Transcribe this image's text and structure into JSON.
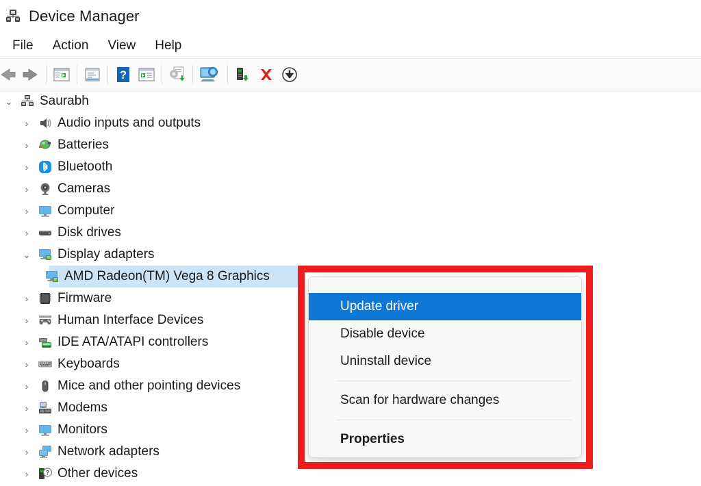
{
  "window": {
    "title": "Device Manager",
    "app_icon": "device-manager-icon"
  },
  "menubar": {
    "items": [
      {
        "label": "File"
      },
      {
        "label": "Action"
      },
      {
        "label": "View"
      },
      {
        "label": "Help"
      }
    ]
  },
  "toolbar": {
    "buttons": [
      {
        "icon": "back-arrow-icon",
        "label": "Back"
      },
      {
        "icon": "forward-arrow-icon",
        "label": "Forward"
      },
      {
        "icon": "show-hide-console-tree-icon",
        "label": "Show/Hide Console Tree"
      },
      {
        "icon": "properties-icon",
        "label": "Properties"
      },
      {
        "icon": "help-icon",
        "label": "Help"
      },
      {
        "icon": "update-driver-panel-icon",
        "label": "Update Driver"
      },
      {
        "icon": "update-driver-gear-icon",
        "label": "Update Driver Software"
      },
      {
        "icon": "scan-for-hardware-changes-icon",
        "label": "Scan for hardware changes"
      },
      {
        "icon": "enable-device-icon",
        "label": "Enable device"
      },
      {
        "icon": "uninstall-device-icon",
        "label": "Uninstall device"
      },
      {
        "icon": "disable-device-icon",
        "label": "Disable device"
      }
    ]
  },
  "tree": {
    "nodes": [
      {
        "label": "Saurabh",
        "icon": "computer-root-icon",
        "depth": 0,
        "expander": "expanded",
        "selected": false
      },
      {
        "label": "Audio inputs and outputs",
        "icon": "speaker-icon",
        "depth": 1,
        "expander": "collapsed",
        "selected": false
      },
      {
        "label": "Batteries",
        "icon": "battery-icon",
        "depth": 1,
        "expander": "collapsed",
        "selected": false
      },
      {
        "label": "Bluetooth",
        "icon": "bluetooth-icon",
        "depth": 1,
        "expander": "collapsed",
        "selected": false
      },
      {
        "label": "Cameras",
        "icon": "camera-icon",
        "depth": 1,
        "expander": "collapsed",
        "selected": false
      },
      {
        "label": "Computer",
        "icon": "monitor-icon",
        "depth": 1,
        "expander": "collapsed",
        "selected": false
      },
      {
        "label": "Disk drives",
        "icon": "disk-drive-icon",
        "depth": 1,
        "expander": "collapsed",
        "selected": false
      },
      {
        "label": "Display adapters",
        "icon": "display-adapter-icon",
        "depth": 1,
        "expander": "expanded",
        "selected": false
      },
      {
        "label": "AMD Radeon(TM) Vega 8 Graphics",
        "icon": "display-adapter-icon",
        "depth": 2,
        "expander": "none",
        "selected": true
      },
      {
        "label": "Firmware",
        "icon": "firmware-chip-icon",
        "depth": 1,
        "expander": "collapsed",
        "selected": false
      },
      {
        "label": "Human Interface Devices",
        "icon": "gamepad-icon",
        "depth": 1,
        "expander": "collapsed",
        "selected": false
      },
      {
        "label": "IDE ATA/ATAPI controllers",
        "icon": "ide-controller-icon",
        "depth": 1,
        "expander": "collapsed",
        "selected": false
      },
      {
        "label": "Keyboards",
        "icon": "keyboard-icon",
        "depth": 1,
        "expander": "collapsed",
        "selected": false
      },
      {
        "label": "Mice and other pointing devices",
        "icon": "mouse-icon",
        "depth": 1,
        "expander": "collapsed",
        "selected": false
      },
      {
        "label": "Modems",
        "icon": "modem-icon",
        "depth": 1,
        "expander": "collapsed",
        "selected": false
      },
      {
        "label": "Monitors",
        "icon": "monitor-icon",
        "depth": 1,
        "expander": "collapsed",
        "selected": false
      },
      {
        "label": "Network adapters",
        "icon": "network-adapter-icon",
        "depth": 1,
        "expander": "collapsed",
        "selected": false
      },
      {
        "label": "Other devices",
        "icon": "unknown-device-icon",
        "depth": 1,
        "expander": "collapsed",
        "selected": false
      }
    ],
    "expander_glyphs": {
      "collapsed": "›",
      "expanded": "⌄"
    }
  },
  "context_menu": {
    "items": [
      {
        "label": "Update driver",
        "highlighted": true,
        "bold": false
      },
      {
        "label": "Disable device",
        "highlighted": false,
        "bold": false
      },
      {
        "label": "Uninstall device",
        "highlighted": false,
        "bold": false
      },
      {
        "separator": true
      },
      {
        "label": "Scan for hardware changes",
        "highlighted": false,
        "bold": false
      },
      {
        "separator": true
      },
      {
        "label": "Properties",
        "highlighted": false,
        "bold": true
      }
    ]
  },
  "annotation": {
    "highlight_box_color": "#ee1c1c",
    "menu_highlight_color": "#0f78d4",
    "tree_selection_color": "#cce4f7"
  }
}
